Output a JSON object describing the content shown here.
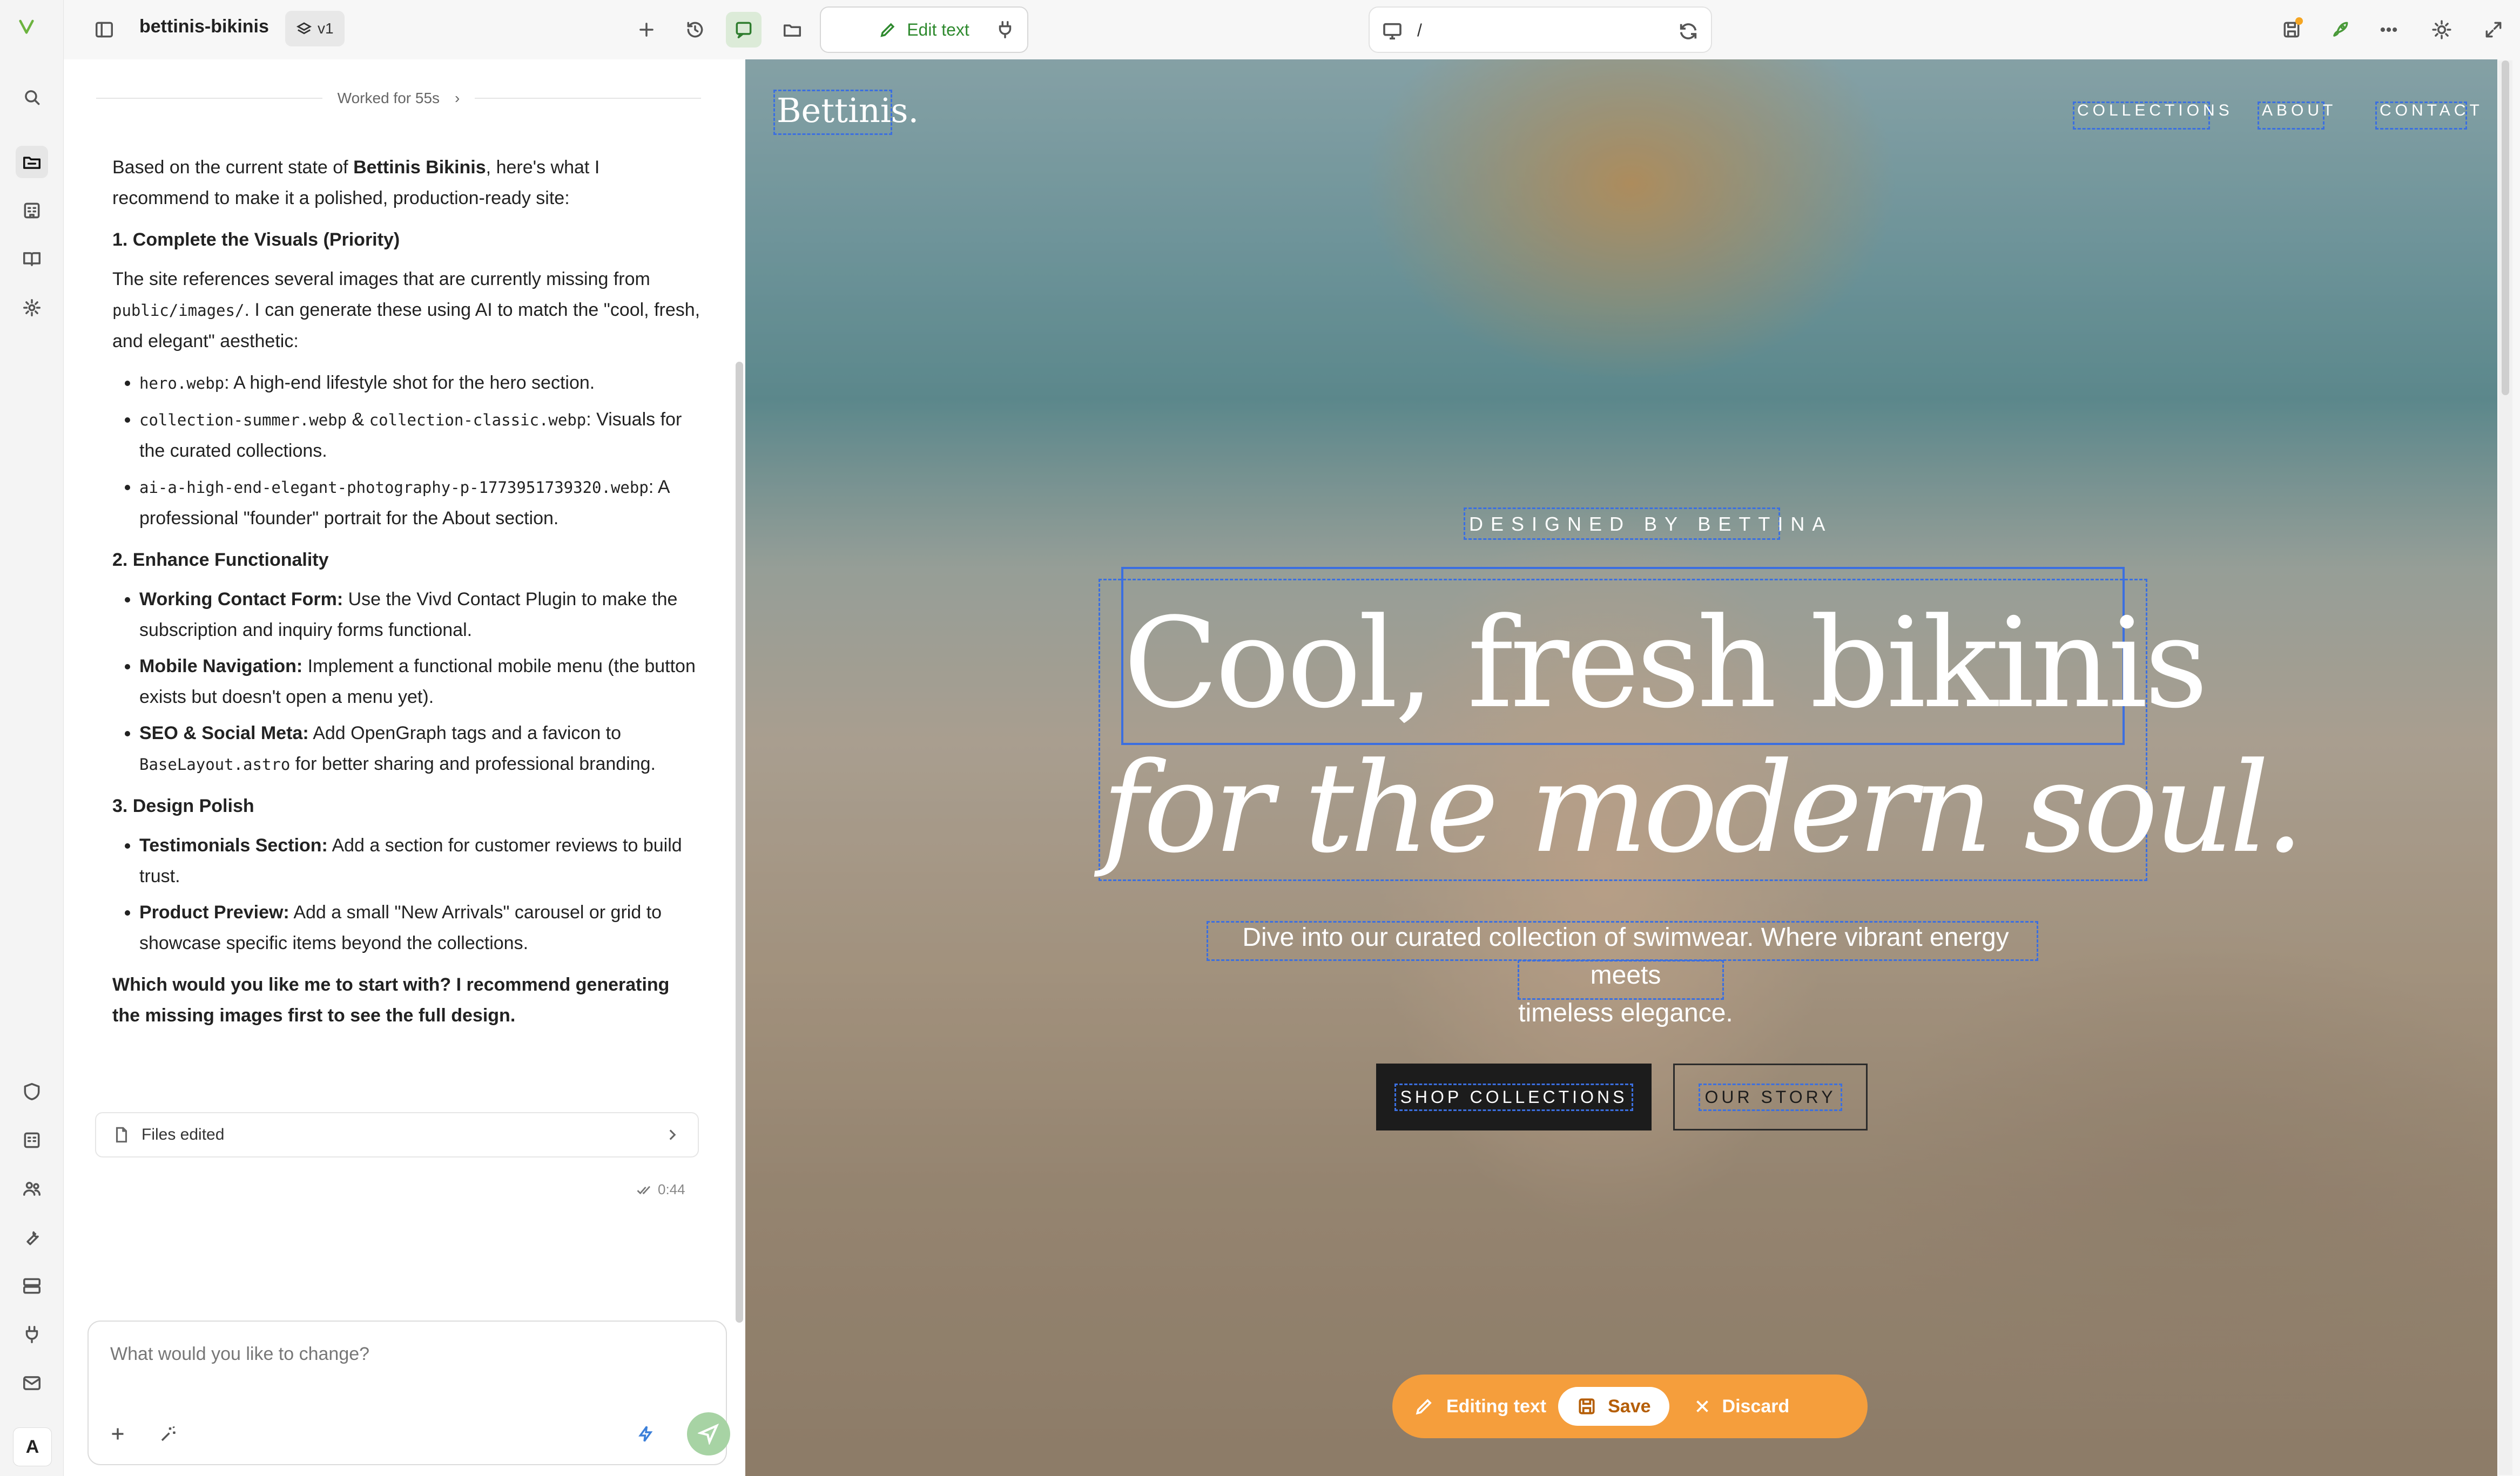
{
  "app": {
    "project_name": "bettinis-bikinis",
    "version": "v1",
    "edit_text_label": "Edit text",
    "url_path": "/",
    "avatar_letter": "A"
  },
  "chat": {
    "worked_label": "Worked for 55s",
    "intro_prefix": "Based on the current state of ",
    "intro_bold": "Bettinis Bikinis",
    "intro_suffix": ", here's what I recommend to make it a polished, production-ready site:",
    "section1_title": "1. Complete the Visuals (Priority)",
    "section1_text_a": "The site references several images that are currently missing from ",
    "section1_code": "public/images/",
    "section1_text_b": ". I can generate these using AI to match the \"cool, fresh, and elegant\" aesthetic:",
    "s1_item1_code": "hero.webp",
    "s1_item1_text": ": A high-end lifestyle shot for the hero section.",
    "s1_item2_code_a": "collection-summer.webp",
    "s1_item2_amp": " & ",
    "s1_item2_code_b": "collection-classic.webp",
    "s1_item2_text": ": Visuals for the curated collections.",
    "s1_item3_code": "ai-a-high-end-elegant-photography-p-1773951739320.webp",
    "s1_item3_text": ": A professional \"founder\" portrait for the About section.",
    "section2_title": "2. Enhance Functionality",
    "s2_item1_bold": "Working Contact Form:",
    "s2_item1_text": " Use the Vivd Contact Plugin to make the subscription and inquiry forms functional.",
    "s2_item2_bold": "Mobile Navigation:",
    "s2_item2_text": " Implement a functional mobile menu (the button exists but doesn't open a menu yet).",
    "s2_item3_bold": "SEO & Social Meta:",
    "s2_item3_text_a": " Add OpenGraph tags and a favicon to ",
    "s2_item3_code": "BaseLayout.astro",
    "s2_item3_text_b": " for better sharing and professional branding.",
    "section3_title": "3. Design Polish",
    "s3_item1_bold": "Testimonials Section:",
    "s3_item1_text": " Add a section for customer reviews to build trust.",
    "s3_item2_bold": "Product Preview:",
    "s3_item2_text": " Add a small \"New Arrivals\" carousel or grid to showcase specific items beyond the collections.",
    "closing": "Which would you like me to start with? I recommend generating the missing images first to see the full design.",
    "files_edited_label": "Files edited",
    "timestamp": "0:44",
    "composer_placeholder": "What would you like to change?"
  },
  "preview": {
    "brand": "Bettinis.",
    "nav": [
      "COLLECTIONS",
      "ABOUT",
      "CONTACT"
    ],
    "eyebrow": "DESIGNED BY BETTINA",
    "headline_1": "Cool, fresh bikinis",
    "headline_2": "for the modern soul.",
    "subtitle_1": "Dive into our curated collection of swimwear. Where vibrant energy meets",
    "subtitle_2": "timeless elegance.",
    "cta_primary": "SHOP COLLECTIONS",
    "cta_secondary": "OUR STORY"
  },
  "edit_toolbar": {
    "status": "Editing text",
    "save": "Save",
    "discard": "Discard"
  },
  "colors": {
    "brand_green": "#2f8a2f",
    "selection_blue": "#3b6fe0",
    "toolbar_orange": "#f59e3c"
  }
}
